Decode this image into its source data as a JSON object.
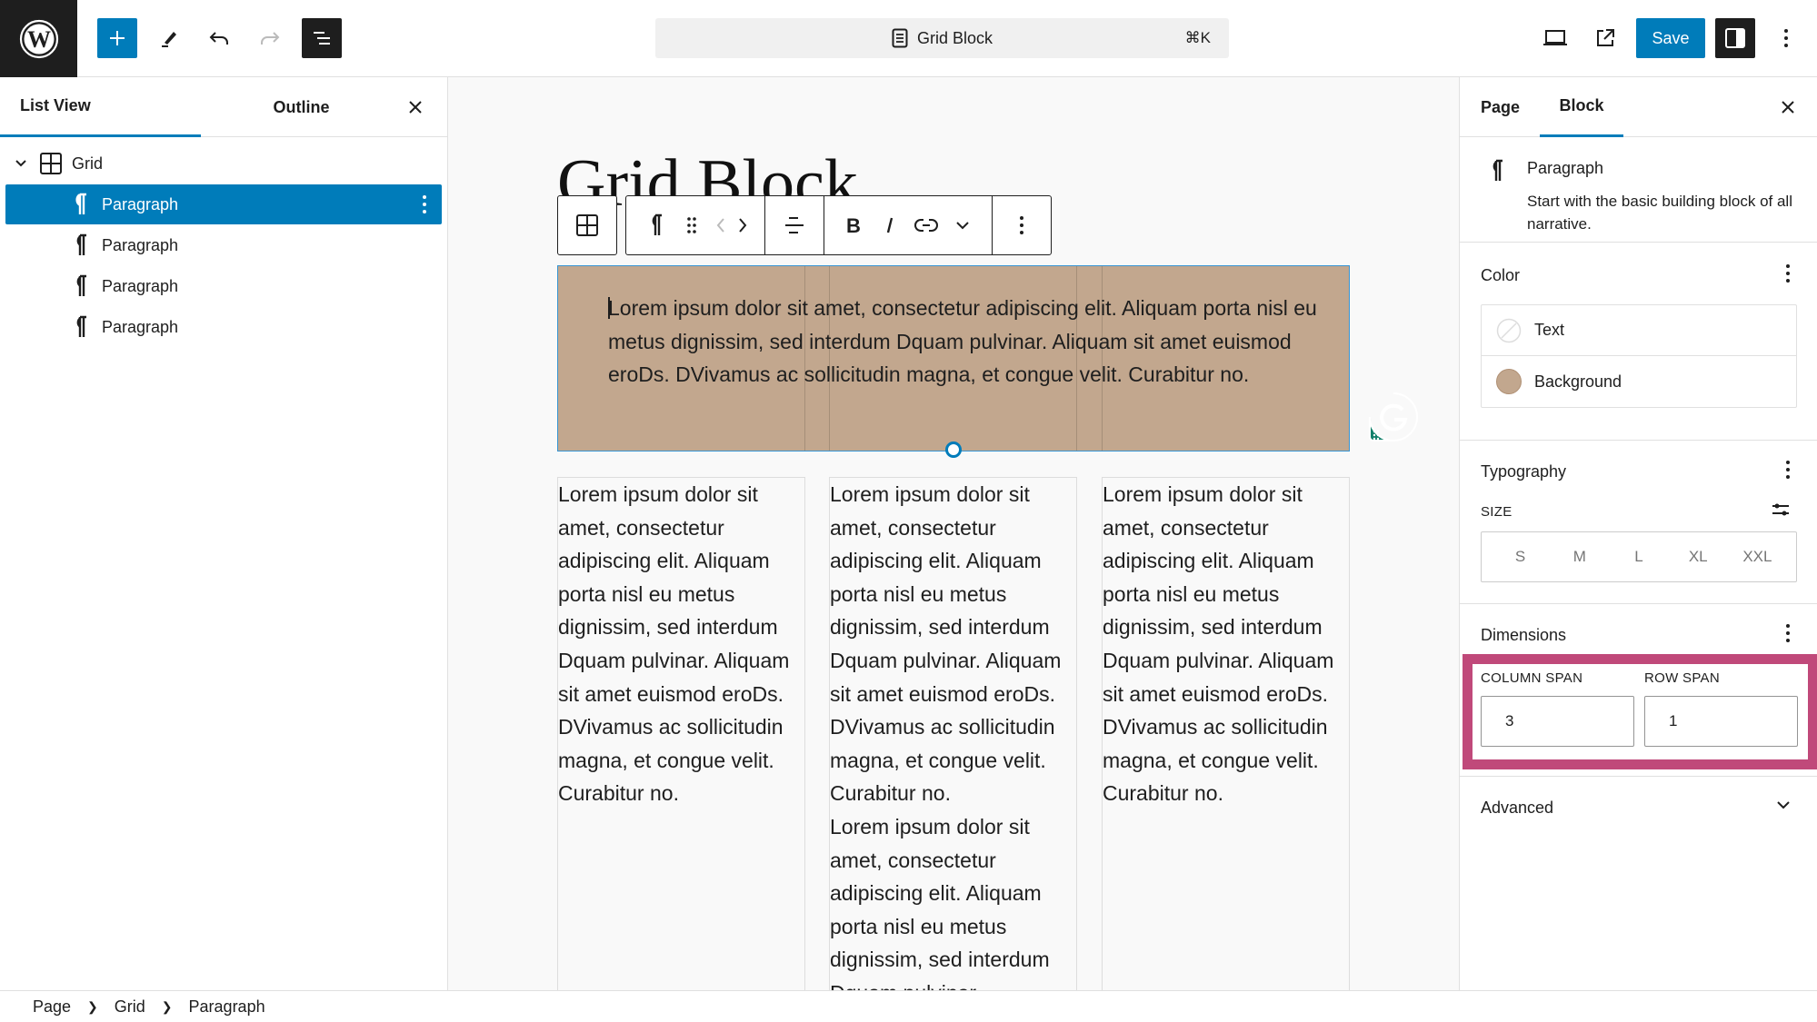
{
  "header": {
    "document_title": "Grid Block",
    "command_shortcut": "⌘K",
    "save_label": "Save",
    "icons": {
      "logo": "wordpress-logo-icon",
      "inserter": "plus-icon",
      "tools": "pencil-icon",
      "undo": "undo-icon",
      "redo": "redo-icon",
      "document_overview": "list-view-icon",
      "preview": "laptop-icon",
      "view_post": "external-link-icon",
      "settings": "sidebar-toggle-icon",
      "options": "more-vertical-icon"
    }
  },
  "left_panel": {
    "tabs": [
      {
        "label": "List View",
        "active": true
      },
      {
        "label": "Outline",
        "active": false
      }
    ],
    "tree": {
      "root": {
        "label": "Grid",
        "expanded": true
      },
      "children": [
        {
          "label": "Paragraph",
          "selected": true
        },
        {
          "label": "Paragraph",
          "selected": false
        },
        {
          "label": "Paragraph",
          "selected": false
        },
        {
          "label": "Paragraph",
          "selected": false
        }
      ]
    }
  },
  "canvas": {
    "post_title": "Grid Block",
    "selected_paragraph": "orem ipsum dolor sit amet, consectetur adipiscing elit. Aliquam porta nisl eu metus dignissim, sed interdum Dquam pulvinar. Aliquam sit amet euismod eroDs. DVivamus ac sollicitudin magna, et congue velit. Curabitur no.",
    "selected_paragraph_first_letter": "L",
    "columns": [
      {
        "paragraphs": [
          "Lorem ipsum dolor sit amet, consectetur adipiscing elit. Aliquam porta nisl eu metus dignissim, sed interdum Dquam pulvinar. Aliquam sit amet euismod eroDs. DVivamus ac sollicitudin magna, et congue velit. Curabitur no."
        ]
      },
      {
        "paragraphs": [
          "Lorem ipsum dolor sit amet, consectetur adipiscing elit. Aliquam porta nisl eu metus dignissim, sed interdum Dquam pulvinar. Aliquam sit amet euismod eroDs. DVivamus ac sollicitudin magna, et congue velit. Curabitur no.",
          "Lorem ipsum dolor sit amet, consectetur adipiscing elit. Aliquam porta nisl eu metus dignissim, sed interdum Dquam pulvinar."
        ]
      },
      {
        "paragraphs": [
          "Lorem ipsum dolor sit amet, consectetur adipiscing elit. Aliquam porta nisl eu metus dignissim, sed interdum Dquam pulvinar. Aliquam sit amet euismod eroDs. DVivamus ac sollicitudin magna, et congue velit. Curabitur no."
        ]
      }
    ],
    "block_background_color": "#c2a78e",
    "toolbar_icons": [
      "grid-icon",
      "paragraph-icon",
      "drag-handle-icon",
      "move-left-icon",
      "move-right-icon",
      "align-icon",
      "bold-icon",
      "italic-icon",
      "link-icon",
      "chevron-down-icon",
      "more-vertical-icon"
    ]
  },
  "right_panel": {
    "tabs": [
      {
        "label": "Page",
        "active": false
      },
      {
        "label": "Block",
        "active": true
      }
    ],
    "block_card": {
      "title": "Paragraph",
      "description": "Start with the basic building block of all narrative."
    },
    "color": {
      "title": "Color",
      "items": [
        {
          "label": "Text",
          "swatch": "none"
        },
        {
          "label": "Background",
          "swatch": "#c2a78e"
        }
      ]
    },
    "typography": {
      "title": "Typography",
      "size_label": "SIZE",
      "sizes": [
        "S",
        "M",
        "L",
        "XL",
        "XXL"
      ]
    },
    "dimensions": {
      "title": "Dimensions",
      "column_span_label": "COLUMN SPAN",
      "column_span_value": "3",
      "row_span_label": "ROW SPAN",
      "row_span_value": "1",
      "highlight_color": "#c0497a"
    },
    "advanced": {
      "title": "Advanced"
    }
  },
  "breadcrumb": [
    "Page",
    "Grid",
    "Paragraph"
  ],
  "colors": {
    "accent": "#007cba",
    "dark": "#1e1e1e"
  }
}
